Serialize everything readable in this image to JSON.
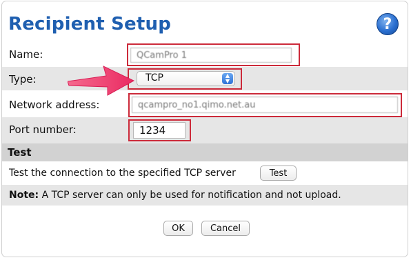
{
  "dialog": {
    "title": "Recipient Setup",
    "help_icon": "?"
  },
  "form": {
    "name_label": "Name:",
    "name_value": "QCamPro 1",
    "type_label": "Type:",
    "type_value": "TCP",
    "network_label": "Network address:",
    "network_value": "qcampro_no1.qimo.net.au",
    "port_label": "Port number:",
    "port_value": "1234"
  },
  "test_section": {
    "header": "Test",
    "description": "Test the connection to the specified TCP server",
    "test_button": "Test"
  },
  "note": {
    "label": "Note:",
    "text": " A TCP server can only be used for notification and not upload."
  },
  "footer": {
    "ok_button": "OK",
    "cancel_button": "Cancel"
  },
  "colors": {
    "title_blue": "#1f5fb0",
    "highlight_red": "#cc2a3a",
    "arrow_pink": "#f0386b"
  }
}
